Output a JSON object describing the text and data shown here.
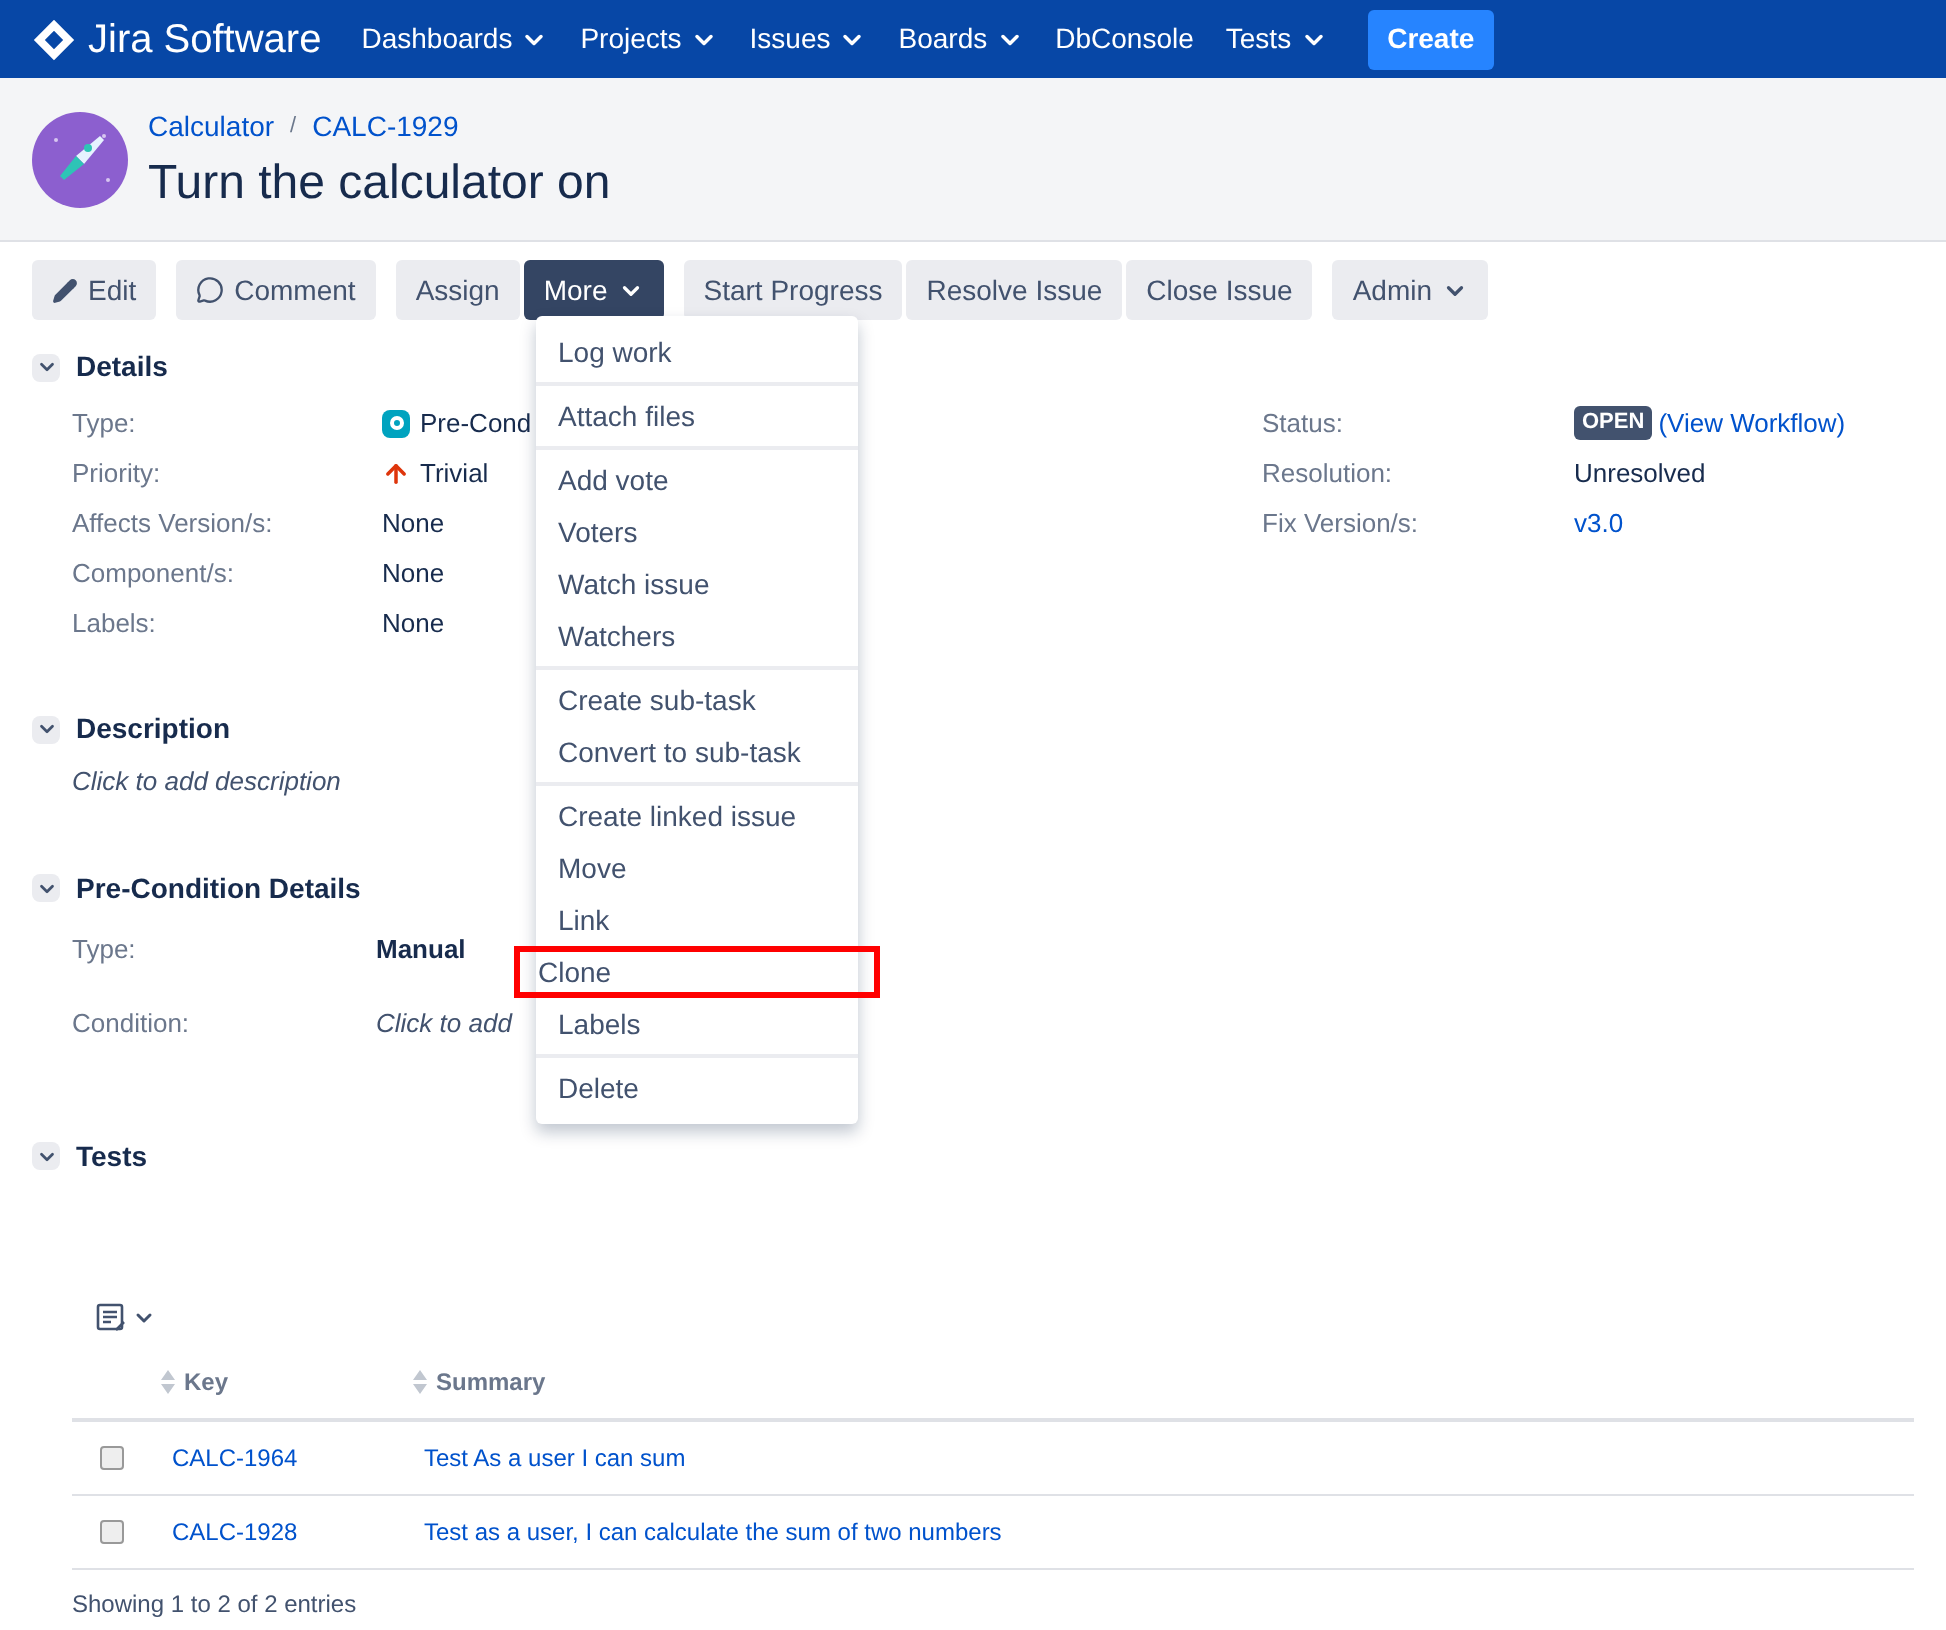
{
  "nav": {
    "logo": "Jira Software",
    "items": [
      {
        "label": "Dashboards",
        "dropdown": true
      },
      {
        "label": "Projects",
        "dropdown": true
      },
      {
        "label": "Issues",
        "dropdown": true
      },
      {
        "label": "Boards",
        "dropdown": true
      },
      {
        "label": "DbConsole",
        "dropdown": false
      },
      {
        "label": "Tests",
        "dropdown": true
      }
    ],
    "create": "Create"
  },
  "breadcrumbs": [
    "Calculator",
    "CALC-1929"
  ],
  "breadcrumb_separator": "/",
  "title": "Turn the calculator on",
  "toolbar": [
    {
      "label": "Edit",
      "dropdown": false,
      "selected": false
    },
    {
      "label": "Comment",
      "dropdown": false,
      "selected": false
    },
    {
      "label": "Assign",
      "dropdown": false,
      "selected": false
    },
    {
      "label": "More",
      "dropdown": true,
      "selected": true
    },
    {
      "label": "Start Progress",
      "dropdown": false,
      "selected": false
    },
    {
      "label": "Resolve Issue",
      "dropdown": false,
      "selected": false
    },
    {
      "label": "Close Issue",
      "dropdown": false,
      "selected": false
    },
    {
      "label": "Admin",
      "dropdown": true,
      "selected": false
    }
  ],
  "menu": [
    [
      {
        "label": "Log work",
        "highlighted": false
      }
    ],
    [
      {
        "label": "Attach files",
        "highlighted": false
      }
    ],
    [
      {
        "label": "Add vote",
        "highlighted": false
      },
      {
        "label": "Voters",
        "highlighted": false
      },
      {
        "label": "Watch issue",
        "highlighted": false
      },
      {
        "label": "Watchers",
        "highlighted": false
      }
    ],
    [
      {
        "label": "Create sub-task",
        "highlighted": false
      },
      {
        "label": "Convert to sub-task",
        "highlighted": false
      }
    ],
    [
      {
        "label": "Create linked issue",
        "highlighted": false
      },
      {
        "label": "Move",
        "highlighted": false
      },
      {
        "label": "Link",
        "highlighted": false
      },
      {
        "label": "Clone",
        "highlighted": true
      },
      {
        "label": "Labels",
        "highlighted": false
      }
    ],
    [
      {
        "label": "Delete",
        "highlighted": false
      }
    ]
  ],
  "details": {
    "heading": "Details",
    "expanded": true,
    "left": [
      {
        "label": "Type:",
        "value": "Pre-Cond",
        "kind": "issue-type"
      },
      {
        "label": "Priority:",
        "value": "Trivial",
        "kind": "priority"
      },
      {
        "label": "Affects Version/s:",
        "value": "None",
        "kind": "text"
      },
      {
        "label": "Component/s:",
        "value": "None",
        "kind": "text"
      },
      {
        "label": "Labels:",
        "value": "None",
        "kind": "text"
      }
    ],
    "right": [
      {
        "label": "Status:",
        "value": "OPEN",
        "link": "(View Workflow)",
        "kind": "status"
      },
      {
        "label": "Resolution:",
        "value": "Unresolved",
        "kind": "text"
      },
      {
        "label": "Fix Version/s:",
        "value": "v3.0",
        "kind": "link"
      }
    ]
  },
  "description": {
    "heading": "Description",
    "expanded": true,
    "placeholder": "Click to add description"
  },
  "precondition": {
    "heading": "Pre-Condition Details",
    "expanded": true,
    "type_label": "Type:",
    "type_value": "Manual",
    "condition_label": "Condition:",
    "condition_placeholder": "Click to add"
  },
  "tests": {
    "heading": "Tests",
    "expanded": true,
    "columns": [
      "Key",
      "Summary"
    ],
    "rows": [
      {
        "key": "CALC-1964",
        "summary": "Test As a user I can sum",
        "checked": false
      },
      {
        "key": "CALC-1928",
        "summary": "Test as a user, I can calculate the sum of two numbers",
        "checked": false
      }
    ],
    "footer": "Showing 1 to 2 of 2 entries"
  }
}
